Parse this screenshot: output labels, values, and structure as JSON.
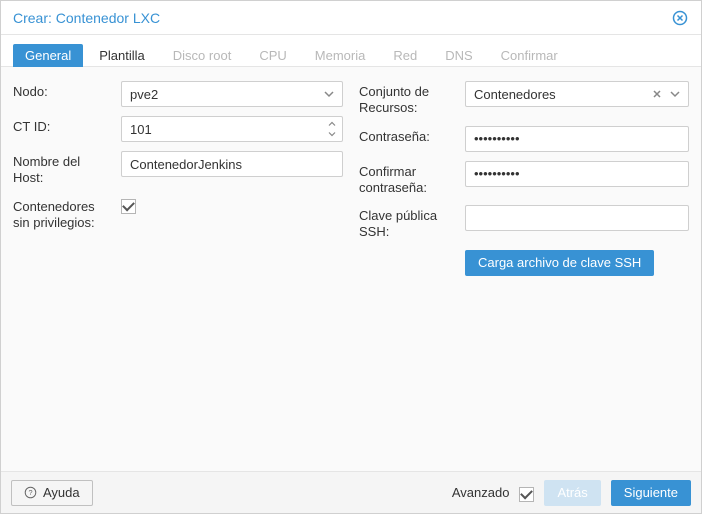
{
  "dialog": {
    "title": "Crear: Contenedor LXC"
  },
  "tabs": {
    "general": "General",
    "plantilla": "Plantilla",
    "disco_root": "Disco root",
    "cpu": "CPU",
    "memoria": "Memoria",
    "red": "Red",
    "dns": "DNS",
    "confirmar": "Confirmar"
  },
  "left": {
    "nodo_label": "Nodo:",
    "nodo_value": "pve2",
    "ctid_label": "CT ID:",
    "ctid_value": "101",
    "hostname_label": "Nombre del Host:",
    "hostname_value": "ContenedorJenkins",
    "unpriv_label": "Contenedores sin privilegios:"
  },
  "right": {
    "pool_label": "Conjunto de Recursos:",
    "pool_value": "Contenedores",
    "pw_label": "Contraseña:",
    "pw_value": "••••••••••",
    "pw2_label": "Confirmar contraseña:",
    "pw2_value": "••••••••••",
    "ssh_label": "Clave pública SSH:",
    "ssh_value": "",
    "ssh_button": "Carga archivo de clave SSH"
  },
  "footer": {
    "help": "Ayuda",
    "advanced": "Avanzado",
    "back": "Atrás",
    "next": "Siguiente"
  }
}
